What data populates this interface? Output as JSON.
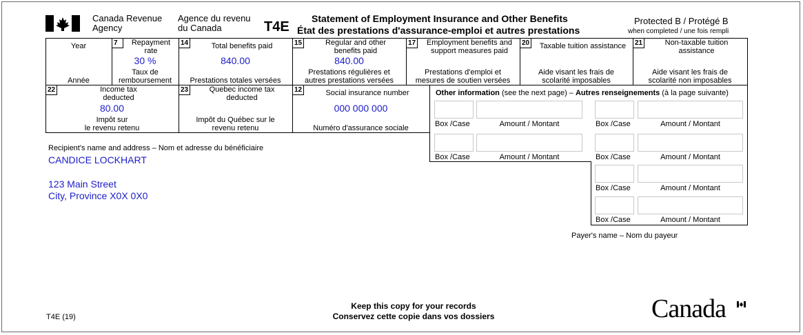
{
  "header": {
    "agency_en_1": "Canada Revenue",
    "agency_en_2": "Agency",
    "agency_fr_1": "Agence du revenu",
    "agency_fr_2": "du Canada",
    "form_code": "T4E",
    "title_en": "Statement of Employment Insurance and Other Benefits",
    "title_fr": "État des prestations d'assurance-emploi et autres prestations",
    "protected": "Protected B / Protégé B",
    "when_completed": "when completed / une fois rempli"
  },
  "row1": {
    "year_en": "Year",
    "year_fr": "Année",
    "box7": {
      "num": "7",
      "label_en_1": "Repayment",
      "label_en_2": "rate",
      "value": "30 %",
      "label_fr_1": "Taux de",
      "label_fr_2": "remboursement"
    },
    "box14": {
      "num": "14",
      "label_en": "Total benefits paid",
      "value": "840.00",
      "label_fr": "Prestations totales versées"
    },
    "box15": {
      "num": "15",
      "label_en_1": "Regular and other",
      "label_en_2": "benefits paid",
      "value": "840.00",
      "label_fr_1": "Prestations régulières et",
      "label_fr_2": "autres prestations versées"
    },
    "box17": {
      "num": "17",
      "label_en_1": "Employment benefits and",
      "label_en_2": "support measures paid",
      "label_fr_1": "Prestations d'emploi et",
      "label_fr_2": "mesures de soutien versées"
    },
    "box20": {
      "num": "20",
      "label_en": "Taxable tuition assistance",
      "label_fr_1": "Aide visant les frais de",
      "label_fr_2": "scolarité imposables"
    },
    "box21": {
      "num": "21",
      "label_en_1": "Non-taxable tuition",
      "label_en_2": "assistance",
      "label_fr_1": "Aide visant les frais de",
      "label_fr_2": "scolarité non imposables"
    }
  },
  "row2": {
    "box22": {
      "num": "22",
      "label_en_1": "Income tax",
      "label_en_2": "deducted",
      "value": "80.00",
      "label_fr_1": "Impôt sur",
      "label_fr_2": "le revenu retenu"
    },
    "box23": {
      "num": "23",
      "label_en_1": "Quebec income tax",
      "label_en_2": "deducted",
      "label_fr_1": "Impôt du Québec sur le",
      "label_fr_2": "revenu retenu"
    },
    "box12": {
      "num": "12",
      "label_en": "Social insurance number",
      "value": "000 000 000",
      "label_fr": "Numéro d'assurance sociale"
    }
  },
  "other_info": {
    "title_bold_1": "Other information",
    "title_mid": " (see the next page) – ",
    "title_bold_2": "Autres renseignements",
    "title_end": " (à la page suivante)",
    "box_label": "Box /Case",
    "amount_label": "Amount / Montant"
  },
  "recipient": {
    "label": "Recipient's name and address – Nom et adresse du bénéficiaire",
    "name": "CANDICE LOCKHART",
    "address_1": "123 Main Street",
    "address_2": "City, Province X0X 0X0"
  },
  "payer_label": "Payer's name – Nom du payeur",
  "footer": {
    "form_version": "T4E (19)",
    "keep_en": "Keep this copy for your records",
    "keep_fr": "Conservez cette copie dans vos dossiers",
    "wordmark": "Canada"
  }
}
